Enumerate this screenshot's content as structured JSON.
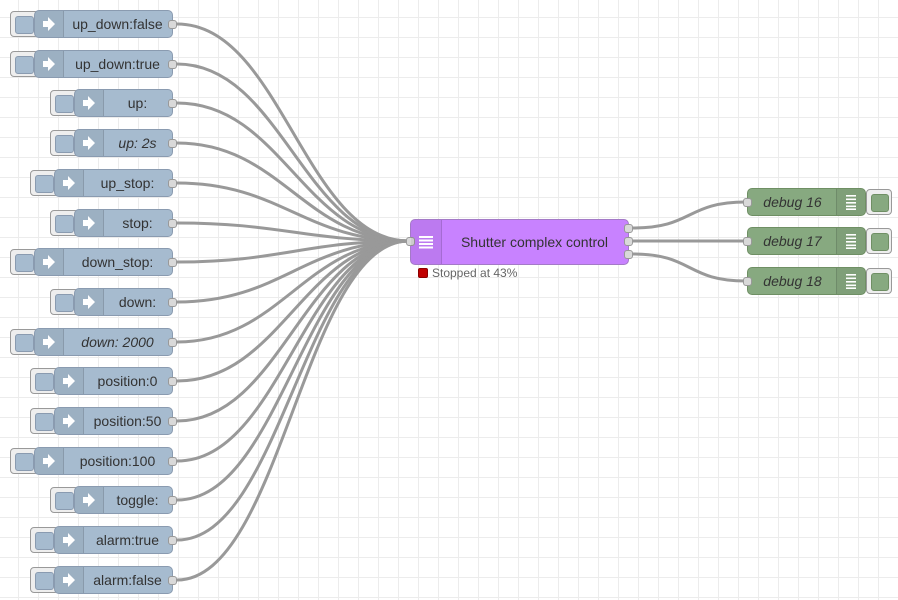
{
  "inject_nodes": [
    {
      "label": "up_down:false",
      "italic": false
    },
    {
      "label": "up_down:true",
      "italic": false
    },
    {
      "label": "up:",
      "italic": false
    },
    {
      "label": "up: 2s",
      "italic": true
    },
    {
      "label": "up_stop:",
      "italic": false
    },
    {
      "label": "stop:",
      "italic": false
    },
    {
      "label": "down_stop:",
      "italic": false
    },
    {
      "label": "down:",
      "italic": false
    },
    {
      "label": "down: 2000",
      "italic": true
    },
    {
      "label": "position:0",
      "italic": false
    },
    {
      "label": "position:50",
      "italic": false
    },
    {
      "label": "position:100",
      "italic": false
    },
    {
      "label": "toggle:",
      "italic": false
    },
    {
      "label": "alarm:true",
      "italic": false
    },
    {
      "label": "alarm:false",
      "italic": false
    }
  ],
  "function_node": {
    "label": "Shutter complex control",
    "status_text": "Stopped at 43%",
    "status_color": "#c00000"
  },
  "debug_nodes": [
    {
      "label": "debug 16"
    },
    {
      "label": "debug 17"
    },
    {
      "label": "debug 18"
    }
  ],
  "colors": {
    "inject": "#a6bbcf",
    "function": "#c882ff",
    "debug": "#87a980",
    "wire": "#999999"
  },
  "icons": {
    "inject": "arrow-right-icon",
    "function": "list-lines-icon",
    "debug": "list-lines-icon"
  }
}
